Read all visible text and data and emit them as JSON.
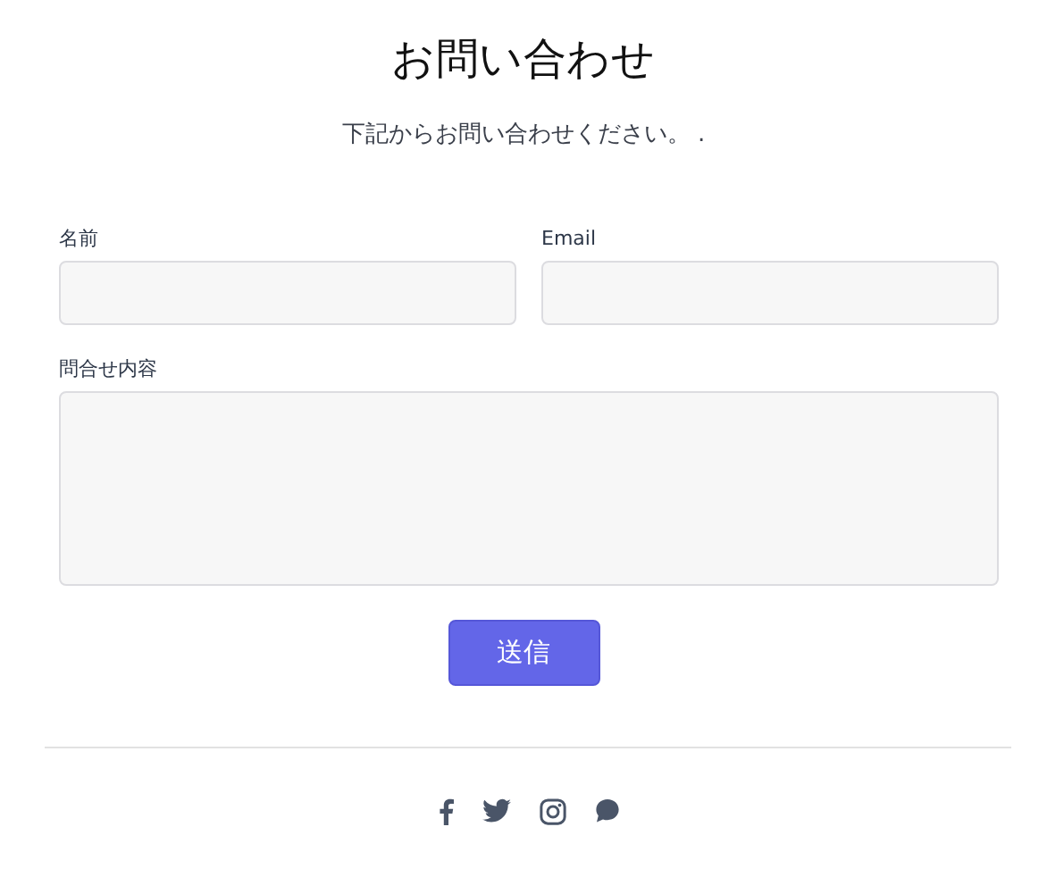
{
  "title": "お問い合わせ",
  "subtitle": "下記からお問い合わせください。 .",
  "fields": [
    {
      "label": "名前",
      "kind": "input"
    },
    {
      "label": "Email",
      "kind": "input"
    },
    {
      "label": "問合せ内容",
      "kind": "textarea"
    }
  ],
  "submit_button": "送信",
  "social_links": [
    {
      "kind": "facebook"
    },
    {
      "kind": "twitter"
    },
    {
      "kind": "instagram"
    },
    {
      "kind": "chat"
    }
  ]
}
